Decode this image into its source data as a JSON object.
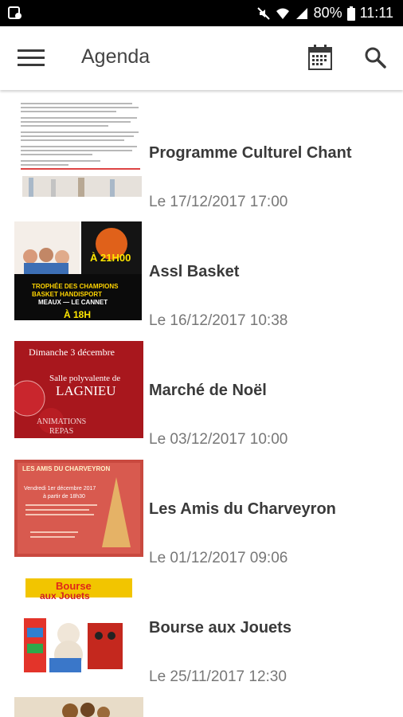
{
  "statusbar": {
    "battery": "80%",
    "time": "11:11"
  },
  "header": {
    "title": "Agenda",
    "menu_icon": "hamburger-menu-icon",
    "calendar_icon": "calendar-icon",
    "search_icon": "search-icon"
  },
  "events": [
    {
      "title": "Programme Culturel Chant",
      "date": "Le 17/12/2017 17:00"
    },
    {
      "title": "Assl Basket",
      "date": "Le 16/12/2017 10:38"
    },
    {
      "title": "Marché de Noël",
      "date": "Le 03/12/2017 10:00"
    },
    {
      "title": "Les Amis du Charveyron",
      "date": "Le 01/12/2017 09:06"
    },
    {
      "title": "Bourse aux Jouets",
      "date": "Le 25/11/2017 12:30"
    }
  ],
  "thumb_text": {
    "basket_a": "À 21H00",
    "basket_b": "À 18H",
    "basket_c": "TROPHÉE DES CHAMPIONS",
    "basket_d": "BASKET HANDISPORT",
    "basket_e": "MEAUX — LE CANNET",
    "noel_a": "Dimanche 3 décembre",
    "noel_b": "Salle polyvalente de",
    "noel_c": "LAGNIEU",
    "noel_d": "ANIMATIONS",
    "noel_e": "REPAS",
    "amis_a": "LES AMIS DU CHARVEYRON",
    "amis_b": "Vendredi 1er décembre 2017",
    "amis_c": "à partir de 18h30",
    "bourse_a": "Bourse",
    "bourse_b": "aux Jouets"
  }
}
